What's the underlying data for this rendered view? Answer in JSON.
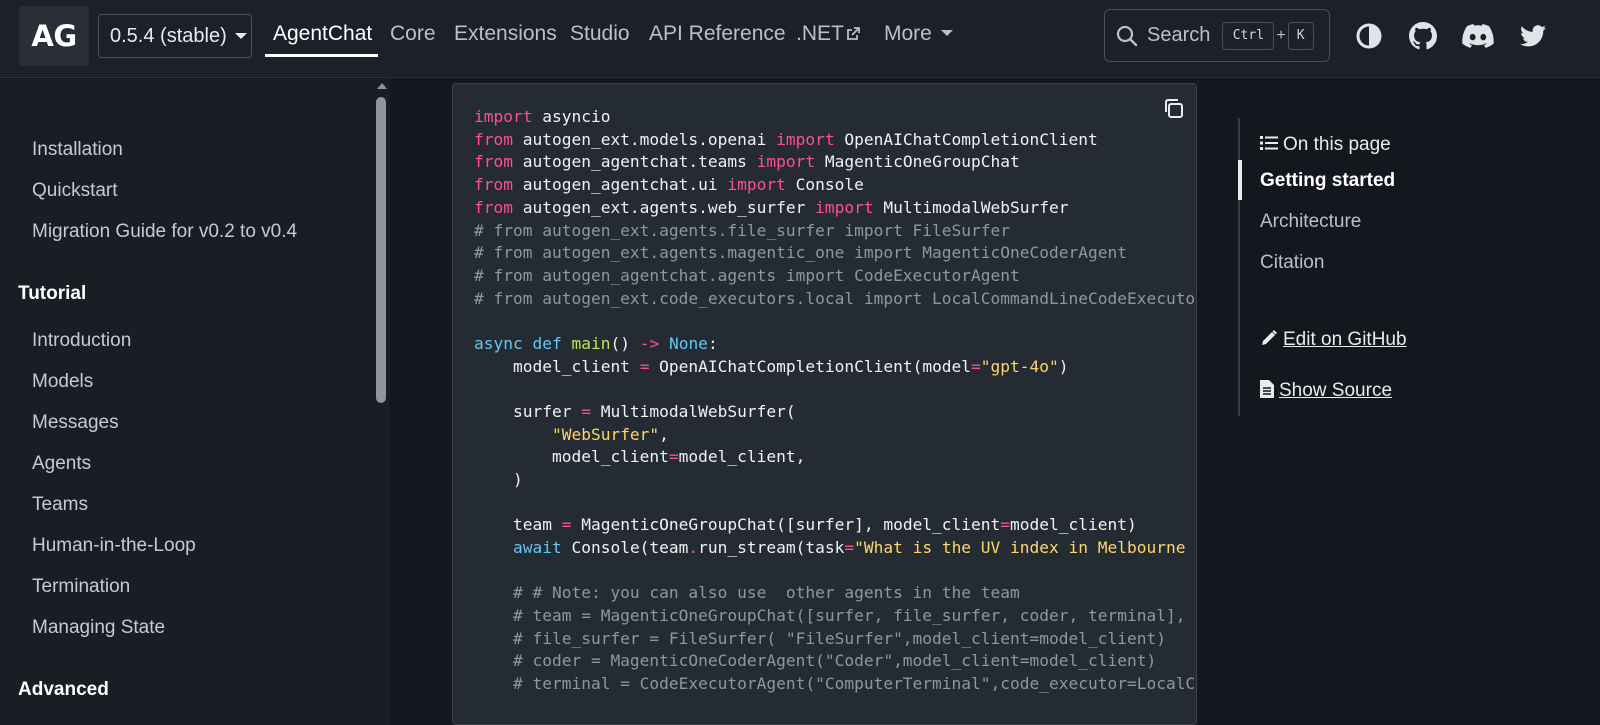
{
  "header": {
    "logo": "AG",
    "version": "0.5.4 (stable)",
    "nav": [
      {
        "label": "AgentChat"
      },
      {
        "label": "Core"
      },
      {
        "label": "Extensions"
      },
      {
        "label": "Studio"
      },
      {
        "label": "API Reference"
      },
      {
        "label": ".NET"
      },
      {
        "label": "More"
      }
    ],
    "search": {
      "label": "Search",
      "key1": "Ctrl",
      "plus": "+",
      "key2": "K"
    },
    "icons": [
      "theme-toggle-icon",
      "github-icon",
      "discord-icon",
      "twitter-icon"
    ]
  },
  "sidebar": {
    "items_top": [
      "Installation",
      "Quickstart",
      "Migration Guide for v0.2 to v0.4"
    ],
    "caption_tutorial": "Tutorial",
    "items_tutorial": [
      "Introduction",
      "Models",
      "Messages",
      "Agents",
      "Teams",
      "Human-in-the-Loop",
      "Termination",
      "Managing State"
    ],
    "caption_advanced": "Advanced"
  },
  "code": {
    "l1": {
      "kw": "import",
      "rest": " asyncio"
    },
    "l2": {
      "kw": "from",
      "mod": " autogen_ext.models.openai ",
      "kw2": "import",
      "name": " OpenAIChatCompletionClient"
    },
    "l3": {
      "kw": "from",
      "mod": " autogen_agentchat.teams ",
      "kw2": "import",
      "name": " MagenticOneGroupChat"
    },
    "l4": {
      "kw": "from",
      "mod": " autogen_agentchat.ui ",
      "kw2": "import",
      "name": " Console"
    },
    "l5": {
      "kw": "from",
      "mod": " autogen_ext.agents.web_surfer ",
      "kw2": "import",
      "name": " MultimodalWebSurfer"
    },
    "c1": "# from autogen_ext.agents.file_surfer import FileSurfer",
    "c2": "# from autogen_ext.agents.magentic_one import MagenticOneCoderAgent",
    "c3": "# from autogen_agentchat.agents import CodeExecutorAgent",
    "c4": "# from autogen_ext.code_executors.local import LocalCommandLineCodeExecutor",
    "l6": {
      "async": "async",
      "def": " def",
      "fn": " main",
      "paren": "()",
      "arrow": " ->",
      "none": " None",
      "colon": ":"
    },
    "l7": {
      "a": "    model_client ",
      "eq": "=",
      "b": " OpenAIChatCompletionClient(model",
      "eq2": "=",
      "str": "\"gpt-4o\"",
      "c": ")"
    },
    "l8": {
      "a": "    surfer ",
      "eq": "=",
      "b": " MultimodalWebSurfer("
    },
    "l9": {
      "a": "        ",
      "str": "\"WebSurfer\"",
      "b": ","
    },
    "l10": {
      "a": "        model_client",
      "eq": "=",
      "b": "model_client,"
    },
    "l11": "    )",
    "l12": {
      "a": "    team ",
      "eq": "=",
      "b": " MagenticOneGroupChat([surfer], model_client",
      "eq2": "=",
      "c": "model_client)"
    },
    "l13": {
      "kw": "    await",
      "a": " Console(team",
      "dot": ".",
      "b": "run_stream(task",
      "eq": "=",
      "str": "\"What is the UV index in Melbourne today?\"",
      "c": "))"
    },
    "c5": "    # # Note: you can also use  other agents in the team",
    "c6": "    # team = MagenticOneGroupChat([surfer, file_surfer, coder, terminal], model_client=model_client)",
    "c7": "    # file_surfer = FileSurfer( \"FileSurfer\",model_client=model_client)",
    "c8": "    # coder = MagenticOneCoderAgent(\"Coder\",model_client=model_client)",
    "c9": "    # terminal = CodeExecutorAgent(\"ComputerTerminal\",code_executor=LocalCommandLineCodeExecutor())"
  },
  "toc": {
    "title": "On this page",
    "items": [
      "Getting started",
      "Architecture",
      "Citation"
    ],
    "edit": "Edit on GitHub",
    "source": "Show Source"
  }
}
